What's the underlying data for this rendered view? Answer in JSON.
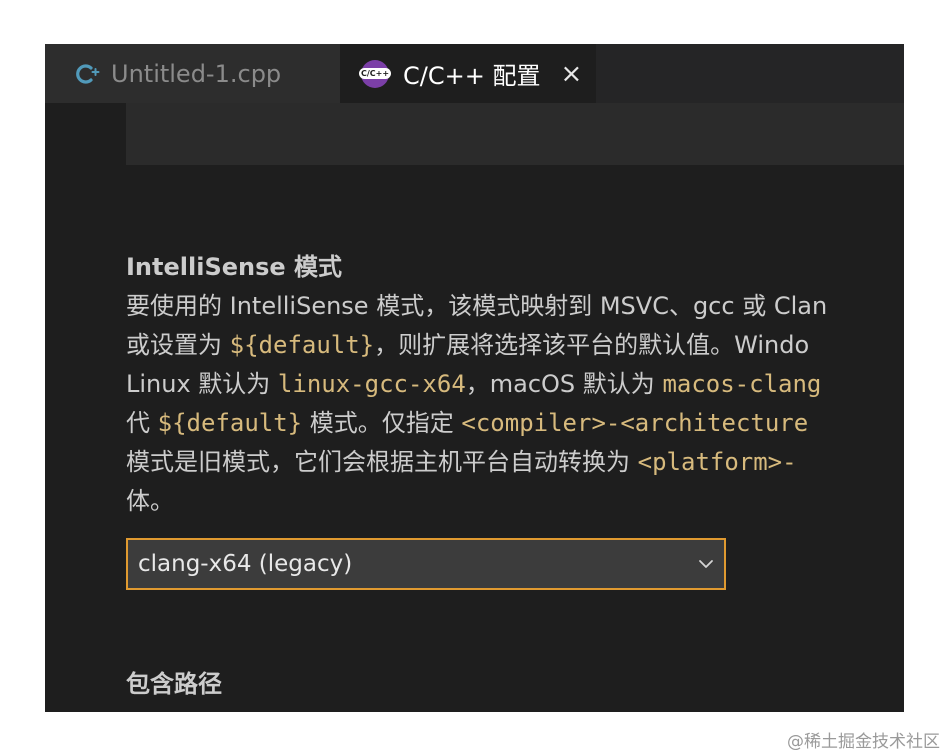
{
  "tabs": [
    {
      "label": "Untitled-1.cpp",
      "icon": "cpp-file-icon",
      "active": false
    },
    {
      "label": "C/C++ 配置",
      "icon": "cpp-config-icon",
      "active": true,
      "badge_text": "C/C++"
    }
  ],
  "intellisense": {
    "title": "IntelliSense 模式",
    "description_lines": [
      [
        {
          "t": "要使用的 IntelliSense 模式，该模式映射到 MSVC、gcc 或 Clan",
          "code": false
        }
      ],
      [
        {
          "t": "或设置为 ",
          "code": false
        },
        {
          "t": "${default}",
          "code": true
        },
        {
          "t": "，则扩展将选择该平台的默认值。Windo",
          "code": false
        }
      ],
      [
        {
          "t": "Linux 默认为 ",
          "code": false
        },
        {
          "t": "linux-gcc-x64",
          "code": true
        },
        {
          "t": "，macOS 默认为 ",
          "code": false
        },
        {
          "t": "macos-clang",
          "code": true
        }
      ],
      [
        {
          "t": "代 ",
          "code": false
        },
        {
          "t": "${default}",
          "code": true
        },
        {
          "t": " 模式。仅指定 ",
          "code": false
        },
        {
          "t": "<compiler>-<architecture",
          "code": true
        }
      ],
      [
        {
          "t": "模式是旧模式，它们会根据主机平台自动转换为 ",
          "code": false
        },
        {
          "t": "<platform>-",
          "code": true
        }
      ],
      [
        {
          "t": "体。",
          "code": false
        }
      ]
    ],
    "selected_value": "clang-x64 (legacy)"
  },
  "include_path": {
    "title": "包含路径"
  },
  "watermark": "@稀土掘金技术社区",
  "colors": {
    "background": "#1e1e1e",
    "code_text": "#d7ba7d",
    "select_border": "#e09a30",
    "icon_purple": "#7b3fa7",
    "cpp_icon_blue": "#519aba"
  }
}
